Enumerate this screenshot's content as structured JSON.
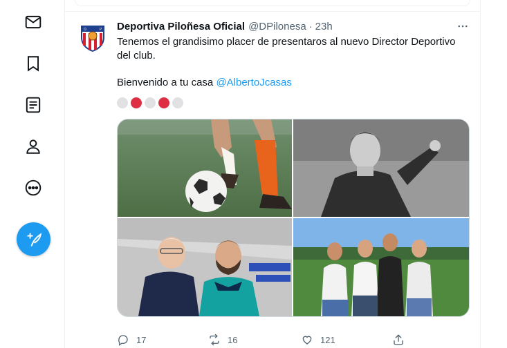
{
  "nav": {
    "items": [
      "messages",
      "bookmarks",
      "lists",
      "profile",
      "more"
    ],
    "compose_label": "Tweet"
  },
  "tweet": {
    "display_name": "Deportiva Piloñesa Oficial",
    "handle": "@DPilonesa",
    "separator": "·",
    "time": "23h",
    "text_line1": "Tenemos el grandisimo placer de presentaros al nuevo Director Deportivo del club.",
    "text_line2_prefix": "Bienvenido a tu casa ",
    "mention": "@AlbertoJcasas",
    "emojis": [
      "white",
      "red",
      "white",
      "red",
      "white"
    ],
    "media_count": 4,
    "stats": {
      "replies": "17",
      "retweets": "16",
      "likes": "121"
    }
  },
  "colors": {
    "accent": "#1d9bf0",
    "text_secondary": "#536471",
    "heart_red": "#dd2e44"
  }
}
